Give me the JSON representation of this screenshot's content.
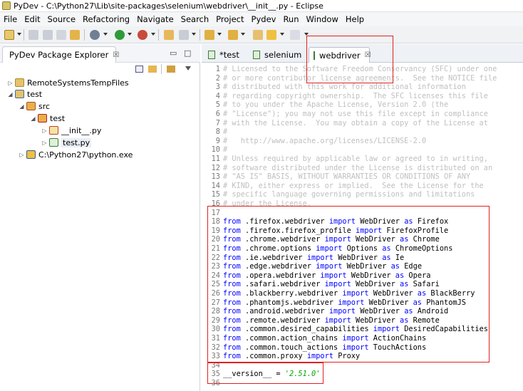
{
  "window": {
    "title": "PyDev - C:\\Python27\\Lib\\site-packages\\selenium\\webdriver\\__init__.py - Eclipse"
  },
  "menu": [
    "File",
    "Edit",
    "Source",
    "Refactoring",
    "Navigate",
    "Search",
    "Project",
    "Pydev",
    "Run",
    "Window",
    "Help"
  ],
  "explorer": {
    "tab_label": "PyDev Package Explorer",
    "tree": [
      {
        "label": "RemoteSystemsTempFiles",
        "depth": 0,
        "expanded": false,
        "icon": "folder-icon"
      },
      {
        "label": "test",
        "depth": 0,
        "expanded": true,
        "icon": "project-icon"
      },
      {
        "label": "src",
        "depth": 1,
        "expanded": true,
        "icon": "source-folder-icon"
      },
      {
        "label": "test",
        "depth": 2,
        "expanded": true,
        "icon": "package-icon"
      },
      {
        "label": "__init__.py",
        "depth": 3,
        "expanded": false,
        "icon": "python-init-icon"
      },
      {
        "label": "test.py",
        "depth": 3,
        "expanded": false,
        "icon": "python-file-icon",
        "selected": true
      },
      {
        "label": "C:\\Python27\\python.exe",
        "depth": 1,
        "expanded": false,
        "icon": "interpreter-icon"
      }
    ]
  },
  "editor": {
    "tabs": [
      {
        "label": "*test",
        "active": false
      },
      {
        "label": "selenium",
        "active": false
      },
      {
        "label": "webdriver",
        "active": true
      }
    ],
    "lines": [
      {
        "n": "1",
        "t": "# Licensed to the Software Freedom Conservancy (SFC) under one"
      },
      {
        "n": "2",
        "t": "# or more contributor license agreements.  See the NOTICE file"
      },
      {
        "n": "3",
        "t": "# distributed with this work for additional information"
      },
      {
        "n": "4",
        "t": "# regarding copyright ownership.  The SFC licenses this file"
      },
      {
        "n": "5",
        "t": "# to you under the Apache License, Version 2.0 (the"
      },
      {
        "n": "6",
        "t": "# \"License\"); you may not use this file except in compliance"
      },
      {
        "n": "7",
        "t": "# with the License.  You may obtain a copy of the License at"
      },
      {
        "n": "8",
        "t": "#"
      },
      {
        "n": "9",
        "t": "#   http://www.apache.org/licenses/LICENSE-2.0"
      },
      {
        "n": "10",
        "t": "#"
      },
      {
        "n": "11",
        "t": "# Unless required by applicable law or agreed to in writing,"
      },
      {
        "n": "12",
        "t": "# software distributed under the License is distributed on an"
      },
      {
        "n": "13",
        "t": "# \"AS IS\" BASIS, WITHOUT WARRANTIES OR CONDITIONS OF ANY"
      },
      {
        "n": "14",
        "t": "# KIND, either express or implied.  See the License for the"
      },
      {
        "n": "15",
        "t": "# specific language governing permissions and limitations"
      },
      {
        "n": "16",
        "t": "# under the License."
      },
      {
        "n": "17",
        "t": ""
      },
      {
        "n": "18",
        "m": ".firefox.webdriver",
        "c": "WebDriver",
        "a": "Firefox"
      },
      {
        "n": "19",
        "m": ".firefox.firefox_profile",
        "c": "FirefoxProfile"
      },
      {
        "n": "20",
        "m": ".chrome.webdriver",
        "c": "WebDriver",
        "a": "Chrome"
      },
      {
        "n": "21",
        "m": ".chrome.options",
        "c": "Options",
        "a": "ChromeOptions"
      },
      {
        "n": "22",
        "m": ".ie.webdriver",
        "c": "WebDriver",
        "a": "Ie"
      },
      {
        "n": "23",
        "m": ".edge.webdriver",
        "c": "WebDriver",
        "a": "Edge"
      },
      {
        "n": "24",
        "m": ".opera.webdriver",
        "c": "WebDriver",
        "a": "Opera"
      },
      {
        "n": "25",
        "m": ".safari.webdriver",
        "c": "WebDriver",
        "a": "Safari"
      },
      {
        "n": "26",
        "m": ".blackberry.webdriver",
        "c": "WebDriver",
        "a": "BlackBerry"
      },
      {
        "n": "27",
        "m": ".phantomjs.webdriver",
        "c": "WebDriver",
        "a": "PhantomJS"
      },
      {
        "n": "28",
        "m": ".android.webdriver",
        "c": "WebDriver",
        "a": "Android"
      },
      {
        "n": "29",
        "m": ".remote.webdriver",
        "c": "WebDriver",
        "a": "Remote"
      },
      {
        "n": "30",
        "m": ".common.desired_capabilities",
        "c": "DesiredCapabilities"
      },
      {
        "n": "31",
        "m": ".common.action_chains",
        "c": "ActionChains"
      },
      {
        "n": "32",
        "m": ".common.touch_actions",
        "c": "TouchActions"
      },
      {
        "n": "33",
        "m": ".common.proxy",
        "c": "Proxy"
      },
      {
        "n": "34",
        "t": ""
      },
      {
        "n": "35",
        "v": "__version__ = ",
        "s": "'2.51.0'"
      },
      {
        "n": "36",
        "t": ""
      }
    ]
  },
  "colors": {
    "keyword": "#0000ff",
    "comment": "#c0c0c0",
    "string": "#00aa00",
    "highlight": "#e02020"
  }
}
